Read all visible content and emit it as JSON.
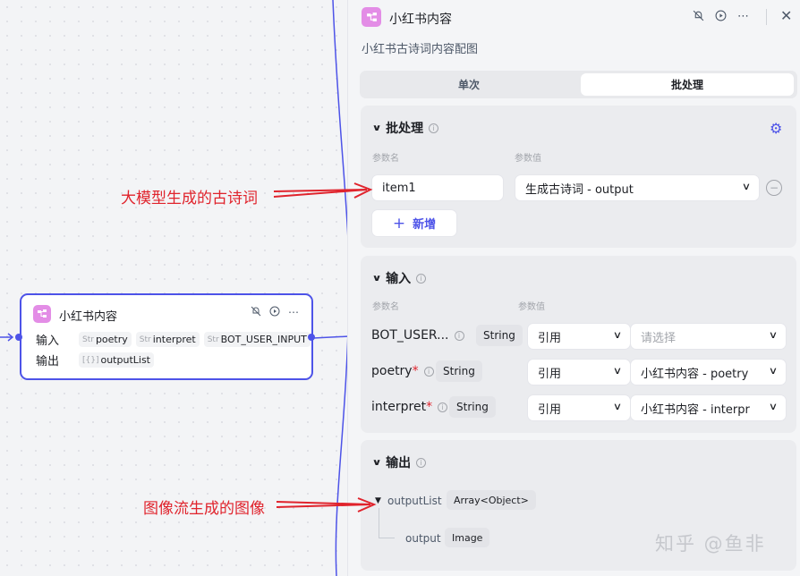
{
  "canvas": {
    "node": {
      "title": "小红书内容",
      "input_label": "输入",
      "output_label": "输出",
      "inputs": [
        {
          "type": "Str",
          "name": "poetry"
        },
        {
          "type": "Str",
          "name": "interpret"
        },
        {
          "type": "Str",
          "name": "BOT_USER_INPUT"
        }
      ],
      "outputs": [
        {
          "type": "[{}]",
          "name": "outputList"
        }
      ]
    },
    "annotations": {
      "model_poem": "大模型生成的古诗词",
      "image_flow": "图像流生成的图像"
    }
  },
  "panel": {
    "title": "小红书内容",
    "description": "小红书古诗词内容配图",
    "actions": [
      "bell-off-icon",
      "play-icon",
      "more-icon",
      "close-icon"
    ],
    "tabs": [
      {
        "label": "单次",
        "active": false
      },
      {
        "label": "批处理",
        "active": true
      }
    ],
    "batch": {
      "title": "批处理",
      "col_name": "参数名",
      "col_value": "参数值",
      "item_name": "item1",
      "item_value": "生成古诗词 - output",
      "add_label": "新增"
    },
    "input": {
      "title": "输入",
      "col_name": "参数名",
      "col_value": "参数值",
      "rows": [
        {
          "name": "BOT_USER...",
          "required": false,
          "type": "String",
          "mode": "引用",
          "value": "请选择",
          "placeholder": true
        },
        {
          "name": "poetry",
          "required": true,
          "type": "String",
          "mode": "引用",
          "value": "小红书内容 - poetry",
          "placeholder": false
        },
        {
          "name": "interpret",
          "required": true,
          "type": "String",
          "mode": "引用",
          "value": "小红书内容 - interpr",
          "placeholder": false
        }
      ]
    },
    "output": {
      "title": "输出",
      "list_name": "outputList",
      "list_type": "Array<Object>",
      "child_name": "output",
      "child_type": "Image"
    }
  },
  "watermark": "知乎 @鱼非",
  "colors": {
    "accent": "#4d53e8",
    "annotation": "#e0232c",
    "badge": "#e38de6"
  }
}
